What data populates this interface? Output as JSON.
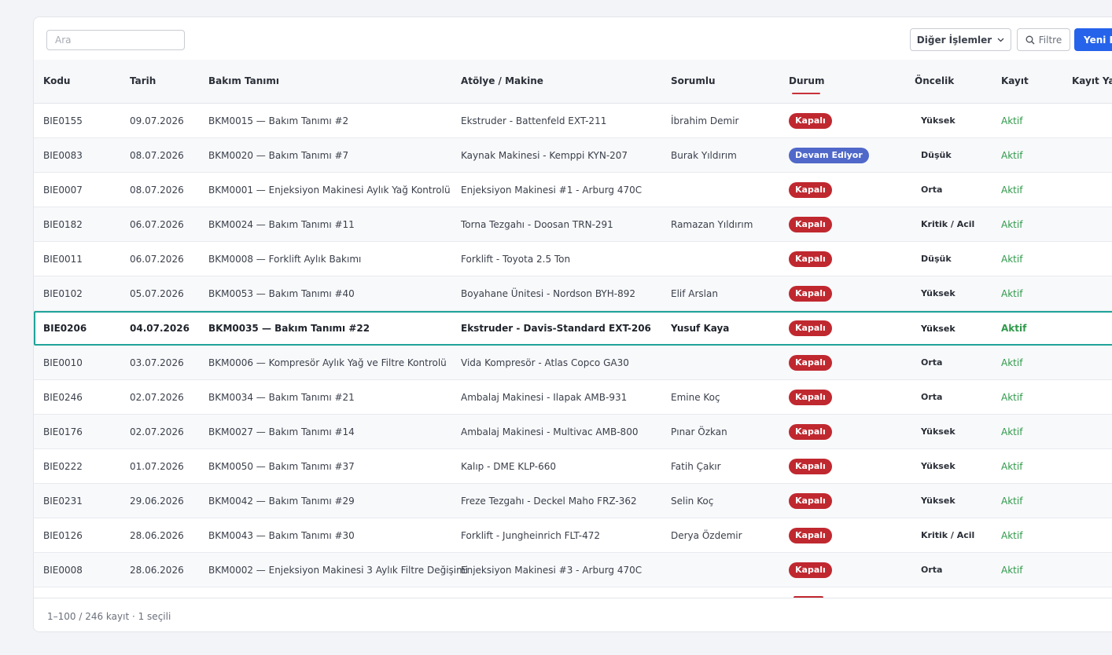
{
  "toolbar": {
    "search_placeholder": "Ara",
    "other_actions_label": "Diğer İşlemler",
    "filter_label": "Filtre",
    "new_button_label": "Yeni Ba"
  },
  "table": {
    "columns": [
      "Kodu",
      "Tarih",
      "Bakım Tanımı",
      "Atölye / Makine",
      "Sorumlu",
      "Durum",
      "Öncelik",
      "Kayıt",
      "Kayıt Yap"
    ],
    "sorted_column": "Durum",
    "rows": [
      {
        "kodu": "BIE0155",
        "tarih": "09.07.2026",
        "tanim": "BKM0015 — Bakım Tanımı #2",
        "atolye": "Ekstruder - Battenfeld EXT-211",
        "sorumlu": "İbrahim Demir",
        "durum": "Kapalı",
        "oncelik": "Yüksek",
        "kayit": "Aktif"
      },
      {
        "kodu": "BIE0083",
        "tarih": "08.07.2026",
        "tanim": "BKM0020 — Bakım Tanımı #7",
        "atolye": "Kaynak Makinesi - Kemppi KYN-207",
        "sorumlu": "Burak Yıldırım",
        "durum": "Devam Ediyor",
        "oncelik": "Düşük",
        "kayit": "Aktif"
      },
      {
        "kodu": "BIE0007",
        "tarih": "08.07.2026",
        "tanim": "BKM0001 — Enjeksiyon Makinesi Aylık Yağ Kontrolü",
        "atolye": "Enjeksiyon Makinesi #1 - Arburg 470C",
        "sorumlu": "",
        "durum": "Kapalı",
        "oncelik": "Orta",
        "kayit": "Aktif"
      },
      {
        "kodu": "BIE0182",
        "tarih": "06.07.2026",
        "tanim": "BKM0024 — Bakım Tanımı #11",
        "atolye": "Torna Tezgahı - Doosan TRN-291",
        "sorumlu": "Ramazan Yıldırım",
        "durum": "Kapalı",
        "oncelik": "Kritik / Acil",
        "kayit": "Aktif"
      },
      {
        "kodu": "BIE0011",
        "tarih": "06.07.2026",
        "tanim": "BKM0008 — Forklift Aylık Bakımı",
        "atolye": "Forklift - Toyota 2.5 Ton",
        "sorumlu": "",
        "durum": "Kapalı",
        "oncelik": "Düşük",
        "kayit": "Aktif"
      },
      {
        "kodu": "BIE0102",
        "tarih": "05.07.2026",
        "tanim": "BKM0053 — Bakım Tanımı #40",
        "atolye": "Boyahane Ünitesi - Nordson BYH-892",
        "sorumlu": "Elif Arslan",
        "durum": "Kapalı",
        "oncelik": "Yüksek",
        "kayit": "Aktif"
      },
      {
        "kodu": "BIE0206",
        "tarih": "04.07.2026",
        "tanim": "BKM0035 — Bakım Tanımı #22",
        "atolye": "Ekstruder - Davis-Standard EXT-206",
        "sorumlu": "Yusuf Kaya",
        "durum": "Kapalı",
        "oncelik": "Yüksek",
        "kayit": "Aktif",
        "selected": true
      },
      {
        "kodu": "BIE0010",
        "tarih": "03.07.2026",
        "tanim": "BKM0006 — Kompresör Aylık Yağ ve Filtre Kontrolü",
        "atolye": "Vida Kompresör - Atlas Copco GA30",
        "sorumlu": "",
        "durum": "Kapalı",
        "oncelik": "Orta",
        "kayit": "Aktif"
      },
      {
        "kodu": "BIE0246",
        "tarih": "02.07.2026",
        "tanim": "BKM0034 — Bakım Tanımı #21",
        "atolye": "Ambalaj Makinesi - Ilapak AMB-931",
        "sorumlu": "Emine Koç",
        "durum": "Kapalı",
        "oncelik": "Orta",
        "kayit": "Aktif"
      },
      {
        "kodu": "BIE0176",
        "tarih": "02.07.2026",
        "tanim": "BKM0027 — Bakım Tanımı #14",
        "atolye": "Ambalaj Makinesi - Multivac AMB-800",
        "sorumlu": "Pınar Özkan",
        "durum": "Kapalı",
        "oncelik": "Yüksek",
        "kayit": "Aktif"
      },
      {
        "kodu": "BIE0222",
        "tarih": "01.07.2026",
        "tanim": "BKM0050 — Bakım Tanımı #37",
        "atolye": "Kalıp - DME KLP-660",
        "sorumlu": "Fatih Çakır",
        "durum": "Kapalı",
        "oncelik": "Yüksek",
        "kayit": "Aktif"
      },
      {
        "kodu": "BIE0231",
        "tarih": "29.06.2026",
        "tanim": "BKM0042 — Bakım Tanımı #29",
        "atolye": "Freze Tezgahı - Deckel Maho FRZ-362",
        "sorumlu": "Selin Koç",
        "durum": "Kapalı",
        "oncelik": "Yüksek",
        "kayit": "Aktif"
      },
      {
        "kodu": "BIE0126",
        "tarih": "28.06.2026",
        "tanim": "BKM0043 — Bakım Tanımı #30",
        "atolye": "Forklift - Jungheinrich FLT-472",
        "sorumlu": "Derya Özdemir",
        "durum": "Kapalı",
        "oncelik": "Kritik / Acil",
        "kayit": "Aktif"
      },
      {
        "kodu": "BIE0008",
        "tarih": "28.06.2026",
        "tanim": "BKM0002 — Enjeksiyon Makinesi 3 Aylık Filtre Değişimi",
        "atolye": "Enjeksiyon Makinesi #3 - Arburg 470C",
        "sorumlu": "",
        "durum": "Kapalı",
        "oncelik": "Orta",
        "kayit": "Aktif"
      }
    ]
  },
  "footer": {
    "summary": "1–100 / 246 kayıt · 1 seçili"
  },
  "colors": {
    "primary": "#2563eb",
    "status_closed": "#c0282f",
    "status_in_progress": "#4f68c9",
    "active_text": "#2f9a4a",
    "selected_border": "#1fa39a"
  },
  "icons": {
    "filter": "search-icon",
    "dropdown": "chevron-down-icon"
  }
}
